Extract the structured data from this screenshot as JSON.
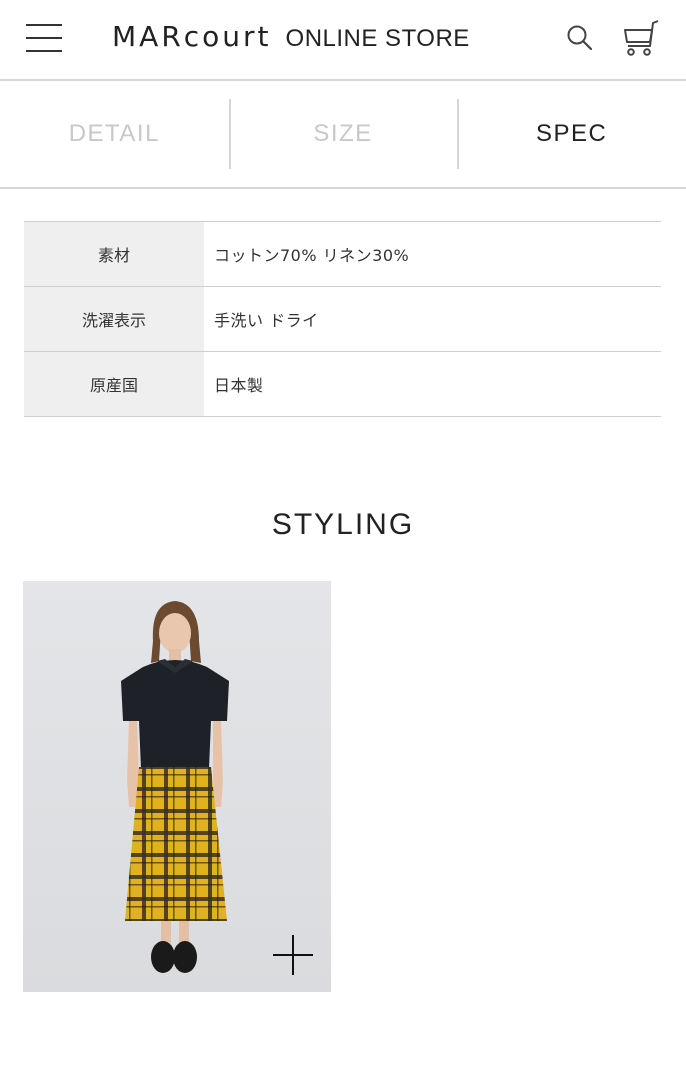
{
  "header": {
    "brand": "MARcourt",
    "store": "ONLINE STORE",
    "menu_icon": "hamburger-menu-icon",
    "search_icon": "search-icon",
    "cart_icon": "cart-icon"
  },
  "tabs": [
    {
      "label": "DETAIL",
      "active": false
    },
    {
      "label": "SIZE",
      "active": false
    },
    {
      "label": "SPEC",
      "active": true
    }
  ],
  "spec": [
    {
      "label": "素材",
      "value": "コットン70% リネン30%"
    },
    {
      "label": "洗濯表示",
      "value": "手洗い ドライ"
    },
    {
      "label": "原産国",
      "value": "日本製"
    }
  ],
  "styling": {
    "title": "STYLING",
    "card_icon": "plus-icon"
  },
  "colors": {
    "text": "#222222",
    "inactive_tab": "#c8c8c8",
    "divider": "#d6d6d6",
    "label_bg": "#efefef",
    "photo_bg": "#dfe1e4",
    "skirt": "#e0b21e",
    "top": "#1e2128"
  }
}
